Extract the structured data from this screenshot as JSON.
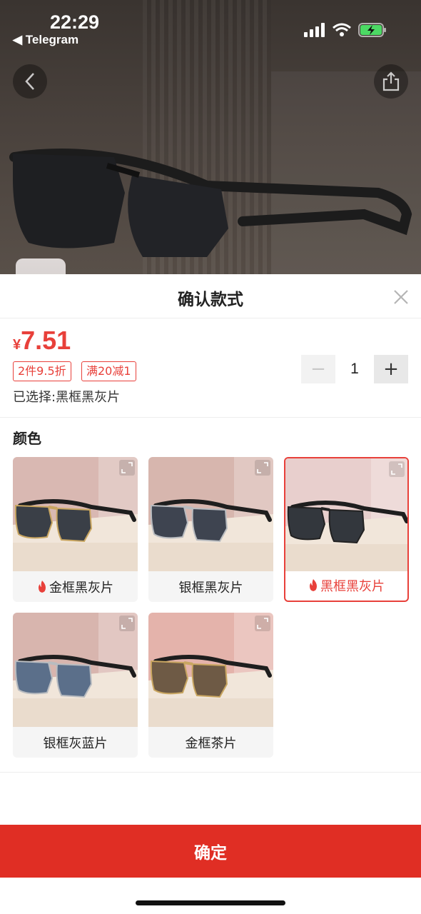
{
  "status_bar": {
    "time": "22:29",
    "back_app": "◀ Telegram"
  },
  "sheet": {
    "title": "确认款式",
    "price_currency": "¥",
    "price_value": "7.51",
    "tags": [
      "2件9.5折",
      "满20减1"
    ],
    "selected_prefix": "已选择:",
    "selected_value": "黑框黑灰片",
    "quantity": "1",
    "minus_symbol": "−",
    "plus_symbol": "+",
    "section_label": "颜色",
    "options": [
      {
        "label": "金框黑灰片",
        "hot": true,
        "selected": false,
        "frame": "#c9a661",
        "lens": "#3a3f47",
        "wall": "#d9b8b2"
      },
      {
        "label": "银框黑灰片",
        "hot": false,
        "selected": false,
        "frame": "#b9bcc0",
        "lens": "#3e4450",
        "wall": "#d7b6ae"
      },
      {
        "label": "黑框黑灰片",
        "hot": true,
        "selected": true,
        "frame": "#222222",
        "lens": "#33373d",
        "wall": "#e8cfcd"
      },
      {
        "label": "银框灰蓝片",
        "hot": false,
        "selected": false,
        "frame": "#b9bcc0",
        "lens": "#5b6f8a",
        "wall": "#d8b5ae"
      },
      {
        "label": "金框茶片",
        "hot": false,
        "selected": false,
        "frame": "#c9a661",
        "lens": "#6e5a45",
        "wall": "#e4b3ab"
      }
    ],
    "confirm_label": "确定"
  },
  "colors": {
    "accent": "#e02e24",
    "price": "#e8403a"
  }
}
